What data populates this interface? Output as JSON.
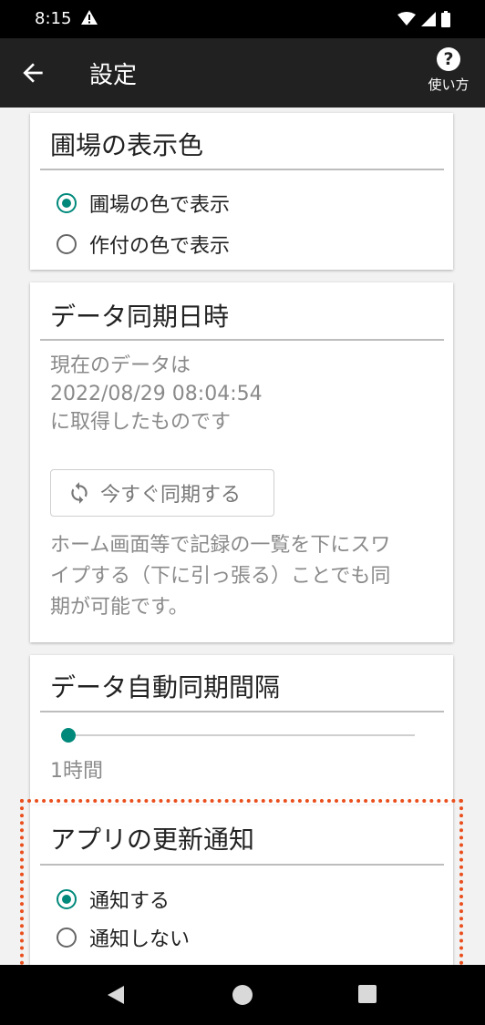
{
  "status_bar": {
    "time": "8:15"
  },
  "app_bar": {
    "title": "設定",
    "help_label": "使い方"
  },
  "display_color": {
    "title": "圃場の表示色",
    "options": [
      {
        "label": "圃場の色で表示",
        "selected": true
      },
      {
        "label": "作付の色で表示",
        "selected": false
      }
    ]
  },
  "sync_time": {
    "title": "データ同期日時",
    "line1": "現在のデータは",
    "timestamp": "2022/08/29 08:04:54",
    "line3": "に取得したものです",
    "sync_button_label": "今すぐ同期する",
    "hint_line1": "ホーム画面等で記録の一覧を下にスワ",
    "hint_line2": "イプする（下に引っ張る）ことでも同",
    "hint_line3": "期が可能です。"
  },
  "auto_sync": {
    "title": "データ自動同期間隔",
    "slider_fraction": 0,
    "value_label": "1時間"
  },
  "update_notification": {
    "title": "アプリの更新通知",
    "options": [
      {
        "label": "通知する",
        "selected": true
      },
      {
        "label": "通知しない",
        "selected": false
      }
    ]
  },
  "colors": {
    "accent": "#00897b",
    "app_bar": "#212121",
    "highlight": "#ea4f1d"
  }
}
